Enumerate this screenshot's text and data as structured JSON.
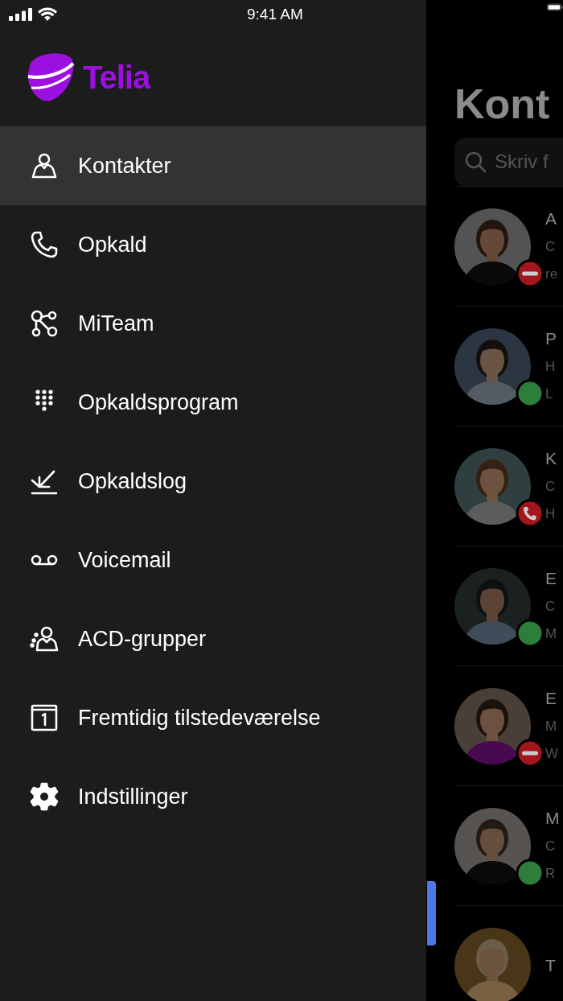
{
  "status_bar": {
    "time": "9:41 AM"
  },
  "drawer": {
    "logo": "Telia",
    "items": [
      {
        "kind": "person",
        "label": "Kontakter",
        "selected": true
      },
      {
        "kind": "phone",
        "label": "Opkald",
        "selected": false
      },
      {
        "kind": "team",
        "label": "MiTeam",
        "selected": false
      },
      {
        "kind": "dialpad",
        "label": "Opkaldsprogram",
        "selected": false
      },
      {
        "kind": "calllog",
        "label": "Opkaldslog",
        "selected": false
      },
      {
        "kind": "voicemail",
        "label": "Voicemail",
        "selected": false
      },
      {
        "kind": "group",
        "label": "ACD-grupper",
        "selected": false
      },
      {
        "kind": "calendar",
        "label": "Fremtidig tilstedeværelse",
        "selected": false
      },
      {
        "kind": "gear",
        "label": "Indstillinger",
        "selected": false
      }
    ]
  },
  "contacts": {
    "title": "Kont",
    "search": {
      "placeholder": "Skriv f"
    },
    "rows": [
      {
        "name": "A",
        "line_1": "C",
        "line_2": "re",
        "kind": "busy",
        "color": "#a3161c"
      },
      {
        "name": "P",
        "line_1": "H",
        "line_2": "L",
        "kind": "available",
        "color": "#2f7d3a"
      },
      {
        "name": "K",
        "line_1": "C",
        "line_2": "H",
        "kind": "on_call",
        "color": "#a3161c"
      },
      {
        "name": "E",
        "line_1": "C",
        "line_2": "M",
        "kind": "available",
        "color": "#2f7d3a"
      },
      {
        "name": "E",
        "line_1": "M",
        "line_2": "W",
        "kind": "busy",
        "color": "#a3161c"
      },
      {
        "name": "M",
        "line_1": "C",
        "line_2": "R",
        "kind": "available",
        "color": "#2f7d3a"
      },
      {
        "name": "T"
      }
    ]
  }
}
